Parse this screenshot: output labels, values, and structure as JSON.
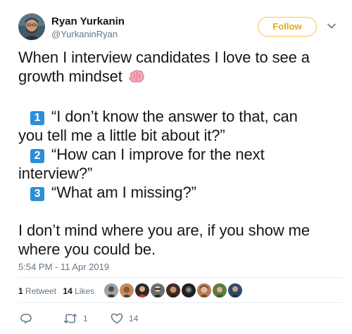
{
  "author": {
    "name": "Ryan Yurkanin",
    "handle": "@YurkaninRyan"
  },
  "follow_label": "Follow",
  "tweet": {
    "line1": "When I interview candidates I love to see a",
    "line2": "growth mindset",
    "items": [
      {
        "badge": "1",
        "first": "“I don’t know the answer to that, can",
        "second": "you tell me a little bit about it?”"
      },
      {
        "badge": "2",
        "first": "“How can I improve for the next",
        "second": "interview?”"
      },
      {
        "badge": "3",
        "first": "“What am I missing?”"
      }
    ],
    "closing1": "I don’t mind where you are, if you show me",
    "closing2": "where you could be."
  },
  "timestamp": "5:54 PM - 11 Apr 2019",
  "stats": {
    "retweets_count": "1",
    "retweets_label": "Retweet",
    "likes_count": "14",
    "likes_label": "Likes"
  },
  "actions": {
    "retweet_count": "1",
    "like_count": "14"
  },
  "colors": {
    "follow": "#e3a91c",
    "badge": "#2d8ed8",
    "muted": "#657786",
    "divider": "#e6ecf0"
  },
  "icons": {
    "reply": "reply-icon",
    "retweet": "retweet-icon",
    "like": "heart-icon",
    "brain": "brain-icon",
    "caret": "chevron-down-icon"
  }
}
